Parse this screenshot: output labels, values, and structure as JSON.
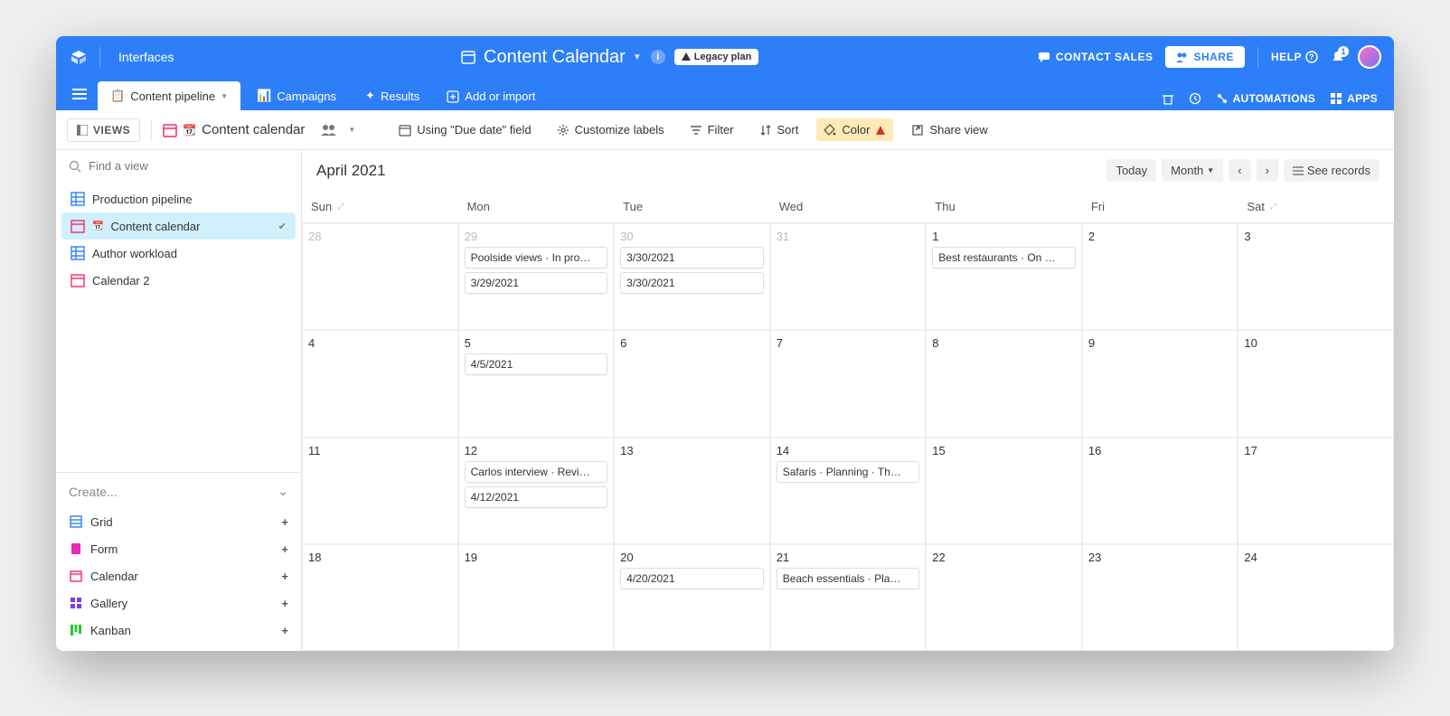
{
  "header": {
    "interfaces": "Interfaces",
    "title": "Content Calendar",
    "legacy": "Legacy plan",
    "contact": "CONTACT SALES",
    "share": "SHARE",
    "help": "HELP",
    "notification_count": "1"
  },
  "tabs": {
    "pipeline": "Content pipeline",
    "campaigns": "Campaigns",
    "results": "Results",
    "add_import": "Add or import",
    "automations": "AUTOMATIONS",
    "apps": "APPS"
  },
  "toolbar": {
    "views": "VIEWS",
    "view_name": "Content calendar",
    "using": "Using \"Due date\" field",
    "customize": "Customize labels",
    "filter": "Filter",
    "sort": "Sort",
    "color": "Color",
    "share_view": "Share view"
  },
  "sidebar": {
    "search_placeholder": "Find a view",
    "views": {
      "prod": "Production pipeline",
      "content": "Content calendar",
      "author": "Author workload",
      "cal2": "Calendar 2"
    },
    "create": "Create...",
    "create_items": {
      "grid": "Grid",
      "form": "Form",
      "calendar": "Calendar",
      "gallery": "Gallery",
      "kanban": "Kanban"
    }
  },
  "calendar": {
    "month_label": "April 2021",
    "today": "Today",
    "scope": "Month",
    "see_records": "See records",
    "days": {
      "sun": "Sun",
      "mon": "Mon",
      "tue": "Tue",
      "wed": "Wed",
      "thu": "Thu",
      "fri": "Fri",
      "sat": "Sat"
    },
    "cells": {
      "d28": "28",
      "d29": "29",
      "d30": "30",
      "d31": "31",
      "d1": "1",
      "d2": "2",
      "d3": "3",
      "d4": "4",
      "d5": "5",
      "d6": "6",
      "d7": "7",
      "d8": "8",
      "d9": "9",
      "d10": "10",
      "d11": "11",
      "d12": "12",
      "d13": "13",
      "d14": "14",
      "d15": "15",
      "d16": "16",
      "d17": "17",
      "d18": "18",
      "d19": "19",
      "d20": "20",
      "d21": "21",
      "d22": "22",
      "d23": "23",
      "d24": "24"
    },
    "events": {
      "e29a": "Poolside views · In pro…",
      "e29b": "3/29/2021",
      "e30a": "3/30/2021",
      "e30b": "3/30/2021",
      "e1a": "Best restaurants · On …",
      "e5a": "4/5/2021",
      "e12a": "Carlos interview · Revi…",
      "e12b": "4/12/2021",
      "e14a": "Safaris · Planning · Th…",
      "e20a": "4/20/2021",
      "e21a": "Beach essentials · Pla…"
    }
  }
}
